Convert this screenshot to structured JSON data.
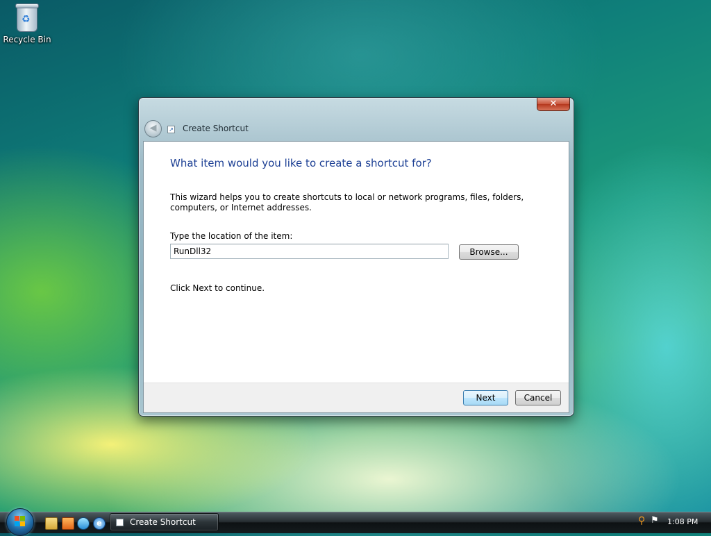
{
  "desktop": {
    "icons": [
      {
        "label": "Recycle Bin",
        "icon": "recycle-bin-icon"
      }
    ]
  },
  "dialog": {
    "title": "Create Shortcut",
    "close_label": "✕",
    "heading": "What item would you like to create a shortcut for?",
    "description": "This wizard helps you to create shortcuts to local or network programs, files, folders, computers, or Internet addresses.",
    "location_label": "Type the location of the item:",
    "location_value": "RunDll32",
    "browse_label": "Browse...",
    "continue_text": "Click Next to continue.",
    "next_label": "Next",
    "cancel_label": "Cancel"
  },
  "taskbar": {
    "quick_launch": [
      "folder-icon",
      "media-player-icon",
      "switch-windows-icon",
      "internet-explorer-icon"
    ],
    "task_button_label": "Create Shortcut",
    "clock": "1:08 PM"
  },
  "colors": {
    "heading": "#1c3f94",
    "close_button": "#c8553b",
    "next_button_border": "#3c7fb1"
  }
}
